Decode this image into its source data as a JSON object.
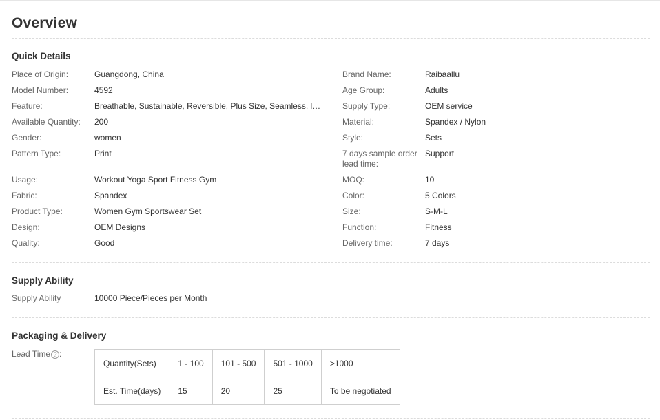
{
  "title": "Overview",
  "quick_details": {
    "heading": "Quick Details",
    "left": [
      {
        "label": "Place of Origin:",
        "value": "Guangdong, China"
      },
      {
        "label": "Model Number:",
        "value": "4592"
      },
      {
        "label": "Feature:",
        "value": "Breathable, Sustainable, Reversible, Plus Size, Seamless, ligh..."
      },
      {
        "label": "Available Quantity:",
        "value": "200"
      },
      {
        "label": "Gender:",
        "value": "women"
      },
      {
        "label": "Pattern Type:",
        "value": "Print"
      },
      {
        "label": "Usage:",
        "value": "Workout Yoga Sport Fitness Gym"
      },
      {
        "label": "Fabric:",
        "value": "Spandex"
      },
      {
        "label": "Product Type:",
        "value": "Women Gym Sportswear Set"
      },
      {
        "label": "Design:",
        "value": "OEM Designs"
      },
      {
        "label": "Quality:",
        "value": "Good"
      }
    ],
    "right": [
      {
        "label": "Brand Name:",
        "value": "Raibaallu"
      },
      {
        "label": "Age Group:",
        "value": "Adults"
      },
      {
        "label": "Supply Type:",
        "value": "OEM service"
      },
      {
        "label": "Material:",
        "value": "Spandex / Nylon"
      },
      {
        "label": "Style:",
        "value": "Sets"
      },
      {
        "label": "7 days sample order lead time:",
        "value": "Support"
      },
      {
        "label": "MOQ:",
        "value": "10"
      },
      {
        "label": "Color:",
        "value": "5 Colors"
      },
      {
        "label": "Size:",
        "value": "S-M-L"
      },
      {
        "label": "Function:",
        "value": "Fitness"
      },
      {
        "label": "Delivery time:",
        "value": "7 days"
      }
    ]
  },
  "supply_ability": {
    "heading": "Supply Ability",
    "label": "Supply Ability",
    "value": "10000 Piece/Pieces per Month"
  },
  "packaging": {
    "heading": "Packaging & Delivery",
    "lead_time_label": "Lead Time",
    "help_icon": "question-circle-icon",
    "help_glyph": "?",
    "lead_time_colon": ":",
    "table": {
      "row1": [
        "Quantity(Sets)",
        "1 - 100",
        "101 - 500",
        "501 - 1000",
        ">1000"
      ],
      "row2": [
        "Est. Time(days)",
        "15",
        "20",
        "25",
        "To be negotiated"
      ]
    }
  }
}
